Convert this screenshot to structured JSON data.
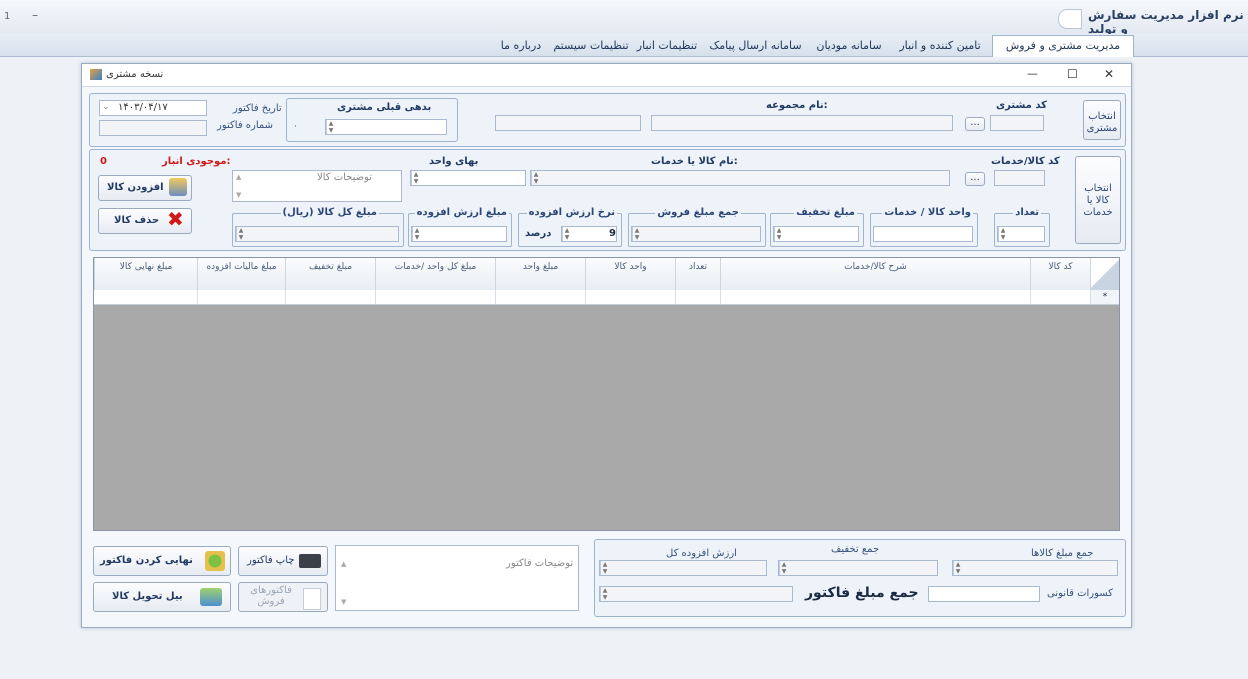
{
  "app": {
    "title": "نرم افزار مدیریت سفارش و تولید",
    "left_marks": [
      "1",
      "–"
    ]
  },
  "menu": {
    "items": [
      "مدیریت مشتری و فروش",
      "تامین کننده و انبار",
      "سامانه مودیان",
      "سامانه ارسال پیامک",
      "تنظیمات انبار",
      "تنظیمات سیستم",
      "درباره ما"
    ],
    "active_index": 0
  },
  "window": {
    "title": "نسخه مشتری",
    "controls": {
      "minimize": "—",
      "maximize": "☐",
      "close": "✕"
    }
  },
  "customer": {
    "select_button": "انتخاب مشتری",
    "code_label": "کد مشتری",
    "browse_label": "...",
    "group_name_label": "نام مجموعه:",
    "previous_debt_label": "بدهی قبلی مشتری",
    "invoice_date_label": "تاریخ فاکتور",
    "invoice_date_value": "۱۴۰۳/۰۴/۱۷",
    "invoice_number_label": "شماره فاکتور"
  },
  "product": {
    "select_button": "انتخاب کالا یا خدمات",
    "code_label": "کد کالا/خدمات",
    "browse_label": "...",
    "name_label": "نام کالا یا خدمات:",
    "unit_price_label": "بهای واحد",
    "stock_label": "موجودی انبار:",
    "stock_value": "0",
    "description_placeholder": "توضیحات کالا",
    "fields": {
      "count": "تعداد",
      "unit": "واحد کالا / خدمات",
      "discount": "مبلغ تخفیف",
      "sales_total": "جمع مبلغ فروش",
      "vat_rate": "نرخ ارزش افزوده",
      "vat_rate_value": "9",
      "vat_rate_unit": "درصد",
      "vat_amount": "مبلغ ارزش افزوده",
      "total_amount": "(مبلغ کل کالا (ریال"
    },
    "add_button": "افزودن کالا",
    "remove_button": "حذف کالا"
  },
  "table": {
    "columns": [
      "کد کالا",
      "شرح کالا/خدمات",
      "تعداد",
      "واحد کالا",
      "مبلغ واحد",
      "مبلغ کل واحد /خدمات",
      "مبلغ تخفیف",
      "مبلغ مالیات افزوده",
      "مبلغ نهایی کالا"
    ],
    "new_row_marker": "*"
  },
  "footer": {
    "goods_total_label": "جمع مبلغ کالاها",
    "discount_total_label": "جمع تخفیف",
    "vat_total_label": "ارزش افزوده کل",
    "legal_deductions_label": "کسورات قانونی",
    "invoice_total_label": "جمع مبلغ فاکتور",
    "invoice_notes_placeholder": "توضیحات فاکتور",
    "print_button": "چاپ فاکتور",
    "sales_invoices_button": "فاکتورهای فروش",
    "finalize_button": "نهایی کردن فاکتور",
    "delivery_button": "بیل تحویل کالا"
  },
  "colors": {
    "accent": "#1d3557",
    "stock_red": "#d01818",
    "grid_bg": "#a9a9a9"
  }
}
